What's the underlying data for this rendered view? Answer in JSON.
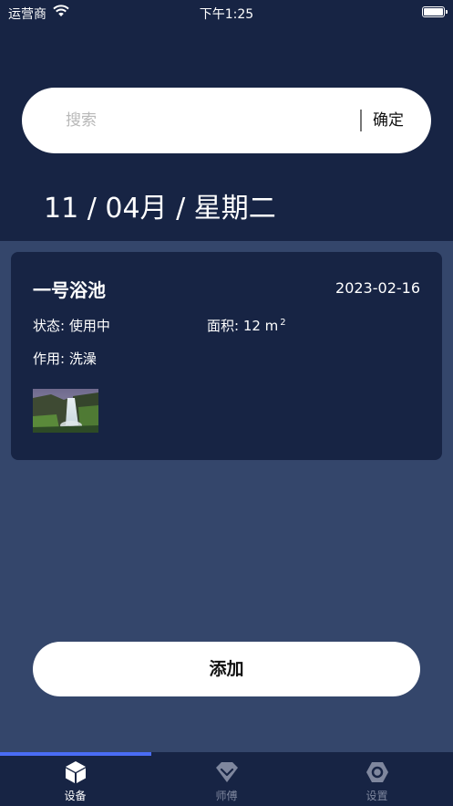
{
  "status_bar": {
    "carrier": "运营商",
    "time": "下午1:25"
  },
  "search": {
    "placeholder": "搜索",
    "value": "",
    "confirm_label": "确定"
  },
  "date_heading": "11 / 04月 / 星期二",
  "card": {
    "title": "一号浴池",
    "date": "2023-02-16",
    "status": "状态: 使用中",
    "area": "面积: 12 m",
    "area_unit_sup": "2",
    "use": "作用: 洗澡"
  },
  "add_button_label": "添加",
  "tabs": [
    {
      "label": "设备",
      "icon": "cube-icon",
      "active": true
    },
    {
      "label": "师傅",
      "icon": "shield-chevron-icon",
      "active": false
    },
    {
      "label": "设置",
      "icon": "hexagon-gear-icon",
      "active": false
    }
  ],
  "colors": {
    "header_background": "#172444",
    "page_background": "#34466b",
    "accent": "#4a6cf5",
    "inactive_tab": "#7f879e"
  }
}
